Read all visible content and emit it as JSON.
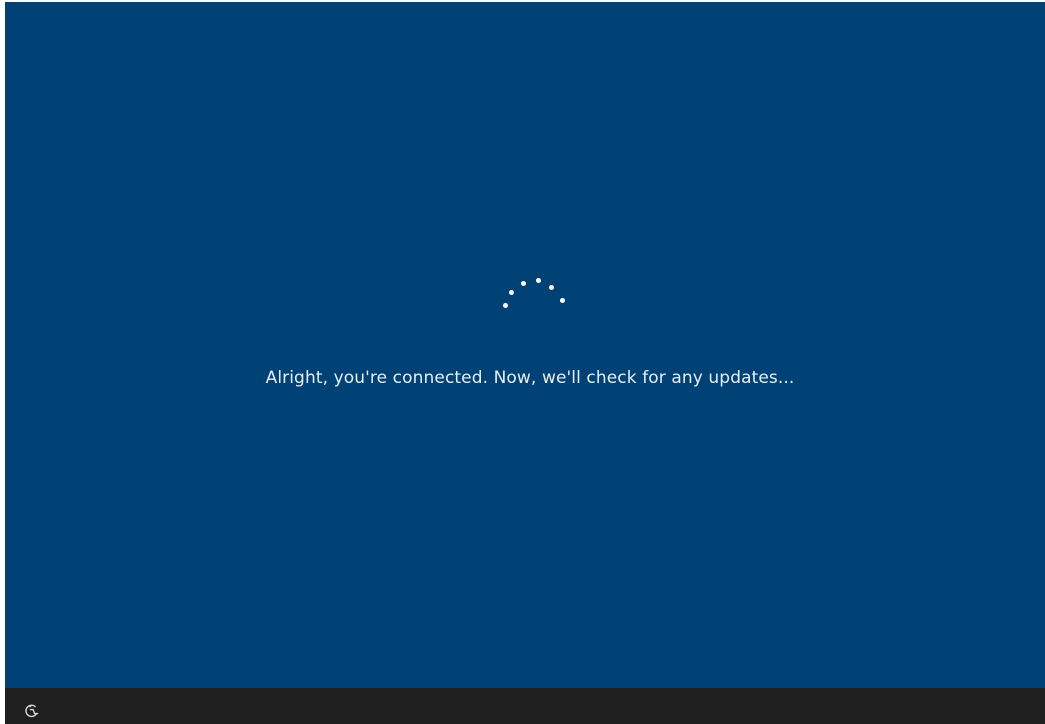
{
  "screen": {
    "background_color": "#004275",
    "bottom_bar_color": "#1f1f1f"
  },
  "spinner": {
    "icon": "loading-dots-icon",
    "dot_color": "#ffffff",
    "dot_count": 6
  },
  "status": {
    "message": "Alright, you're connected. Now, we'll check for any updates..."
  },
  "bottom_bar": {
    "accessibility_icon": "ease-of-access-icon"
  }
}
